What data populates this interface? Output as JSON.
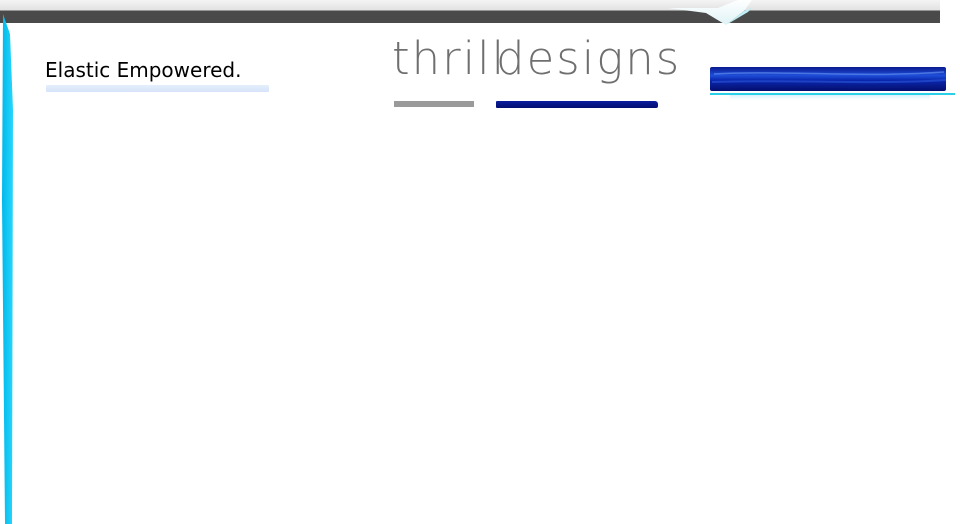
{
  "header": {
    "tagline": "Elastic Empowered.",
    "logo_word_1": "thrill",
    "logo_word_2": "designs"
  },
  "colors": {
    "accent_cyan": "#00c8f5",
    "header_dark": "#4a4a4a",
    "brand_blue": "#0a1e9e",
    "logo_gray": "#6f6f6f"
  }
}
